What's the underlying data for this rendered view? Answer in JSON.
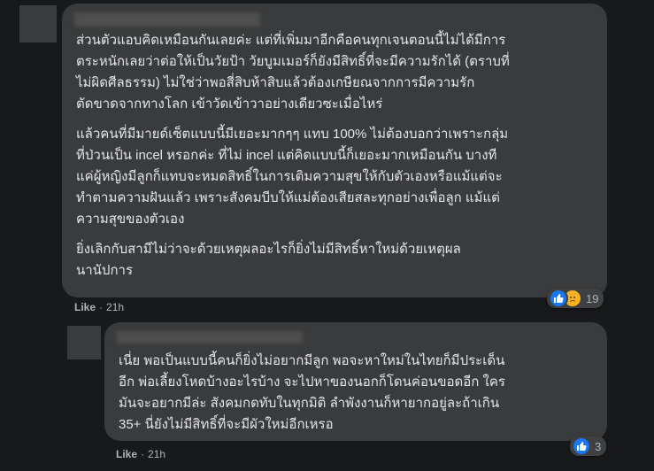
{
  "comments": [
    {
      "author": "",
      "paragraphs": [
        [
          "ส่วนตัวแอบคิดเหมือนกันเลยค่ะ แต่ที่เพิ่มมาอีกคือคนทุกเจนตอนนี้ไม่ได้มีการ",
          "ตระหนักเลยว่าต่อให้เป็นวัยป้า วัยบูมเมอร์ก็ยังมีสิทธิ์ที่จะมีความรักได้ (ตราบที่",
          "ไม่ผิดศีลธรรม) ไม่ใช่ว่าพอสี่สิบห้าสิบแล้วต้องเกษียณจากการมีความรัก",
          "ตัดขาดจากทางโลก เข้าวัดเข้าวาอย่างเดียวซะเมื่อไหร่"
        ],
        [
          "แล้วคนที่มีมายด์เซ็ตแบบนี้มีเยอะมากๆๆ แทบ 100% ไม่ต้องบอกว่าเพราะกลุ่ม",
          "ที่ป่วนเป็น incel หรอกค่ะ ที่ไม่ incel แต่คิดแบบนี้ก็เยอะมากเหมือนกัน บางที",
          "แค่ผู้หญิงมีลูกก็แทบจะหมดสิทธิ์ในการเติมความสุขให้กับตัวเองหรือแม้แต่จะ",
          "ทำตามความฝันแล้ว เพราะสังคมบีบให้แม่ต้องเสียสละทุกอย่างเพื่อลูก แม้แต่",
          "ความสุขของตัวเอง"
        ],
        [
          "ยิ่งเลิกกับสามีไม่ว่าจะด้วยเหตุผลอะไรก็ยิ่งไม่มีสิทธิ์หาใหม่ด้วยเหตุผล",
          "นานัปการ"
        ]
      ],
      "like_label": "Like",
      "time": "21h",
      "reaction_count": "19",
      "reactions": [
        "like-icon",
        "sad-icon"
      ]
    },
    {
      "author": "",
      "paragraphs": [
        [
          "เนี่ย พอเป็นแบบนี้คนก็ยิ่งไม่อยากมีลูก พอจะหาใหม่ในไทยก็มีประเด็น",
          "อีก พ่อเลี้ยงโหดบ้างอะไรบ้าง จะไปหาของนอกก็โดนค่อนขอดอีก ใคร",
          "มันจะอยากมีล่ะ สังคมกดทับในทุกมิติ ลำพังงานก็หายากอยู่ละถ้าเกิน",
          "35+ นี่ยังไม่มีสิทธิ์ที่จะมีผัวใหม่อีกเหรอ"
        ]
      ],
      "like_label": "Like",
      "time": "21h",
      "reaction_count": "3",
      "reactions": [
        "like-icon"
      ]
    }
  ],
  "colors": {
    "background": "#18191a",
    "bubble": "#3a3b3c",
    "text": "#e4e6eb",
    "meta": "#b0b3b8",
    "like_blue": "#1877f2",
    "sad_yellow": "#f7b125"
  }
}
